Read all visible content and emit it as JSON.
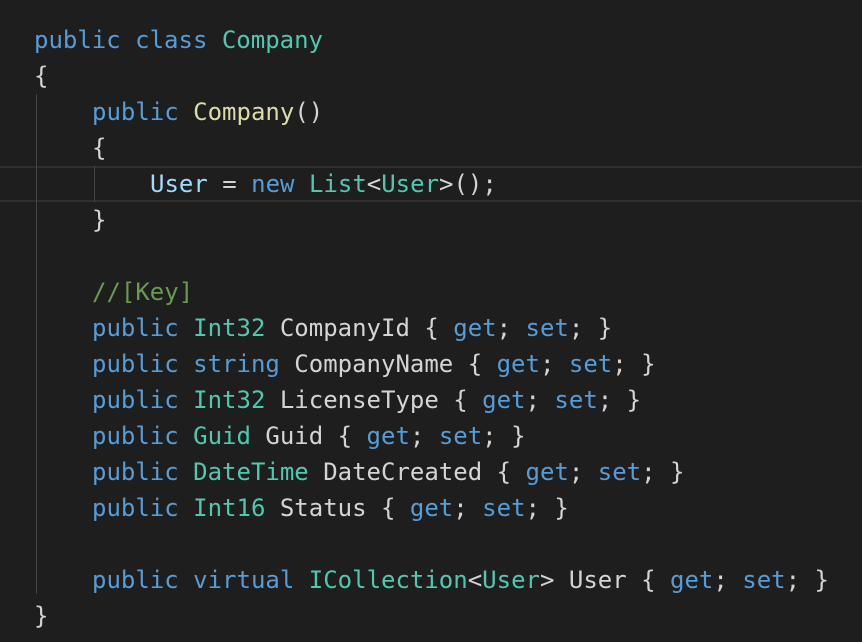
{
  "editor": {
    "colors": {
      "background": "#1e1e1e",
      "keyword": "#569cd6",
      "type": "#4ec9b0",
      "function": "#dcdcaa",
      "variable": "#9cdcfe",
      "comment": "#6a9955",
      "plain": "#d4d4d4"
    },
    "lines": [
      {
        "tokens": [
          {
            "t": "public",
            "c": "kw"
          },
          {
            "t": " ",
            "c": "pl"
          },
          {
            "t": "class",
            "c": "kw"
          },
          {
            "t": " ",
            "c": "pl"
          },
          {
            "t": "Company",
            "c": "type"
          }
        ]
      },
      {
        "tokens": [
          {
            "t": "{",
            "c": "pl"
          }
        ]
      },
      {
        "tokens": [
          {
            "t": "public",
            "c": "kw"
          },
          {
            "t": " ",
            "c": "pl"
          },
          {
            "t": "Company",
            "c": "fn"
          },
          {
            "t": "()",
            "c": "pl"
          }
        ]
      },
      {
        "tokens": [
          {
            "t": "{",
            "c": "pl"
          }
        ]
      },
      {
        "tokens": [
          {
            "t": "User",
            "c": "var"
          },
          {
            "t": " = ",
            "c": "pl"
          },
          {
            "t": "new",
            "c": "kw"
          },
          {
            "t": " ",
            "c": "pl"
          },
          {
            "t": "List",
            "c": "type"
          },
          {
            "t": "<",
            "c": "pl"
          },
          {
            "t": "User",
            "c": "type"
          },
          {
            "t": ">();",
            "c": "pl"
          }
        ]
      },
      {
        "tokens": [
          {
            "t": "}",
            "c": "pl"
          }
        ]
      },
      {
        "tokens": []
      },
      {
        "tokens": [
          {
            "t": "//[Key]",
            "c": "cm"
          }
        ]
      },
      {
        "tokens": [
          {
            "t": "public",
            "c": "kw"
          },
          {
            "t": " ",
            "c": "pl"
          },
          {
            "t": "Int32",
            "c": "type"
          },
          {
            "t": " CompanyId { ",
            "c": "pl"
          },
          {
            "t": "get",
            "c": "kw"
          },
          {
            "t": "; ",
            "c": "pl"
          },
          {
            "t": "set",
            "c": "kw"
          },
          {
            "t": "; }",
            "c": "pl"
          }
        ]
      },
      {
        "tokens": [
          {
            "t": "public",
            "c": "kw"
          },
          {
            "t": " ",
            "c": "pl"
          },
          {
            "t": "string",
            "c": "kw"
          },
          {
            "t": " CompanyName { ",
            "c": "pl"
          },
          {
            "t": "get",
            "c": "kw"
          },
          {
            "t": "; ",
            "c": "pl"
          },
          {
            "t": "set",
            "c": "kw"
          },
          {
            "t": "; }",
            "c": "pl"
          }
        ]
      },
      {
        "tokens": [
          {
            "t": "public",
            "c": "kw"
          },
          {
            "t": " ",
            "c": "pl"
          },
          {
            "t": "Int32",
            "c": "type"
          },
          {
            "t": " LicenseType { ",
            "c": "pl"
          },
          {
            "t": "get",
            "c": "kw"
          },
          {
            "t": "; ",
            "c": "pl"
          },
          {
            "t": "set",
            "c": "kw"
          },
          {
            "t": "; }",
            "c": "pl"
          }
        ]
      },
      {
        "tokens": [
          {
            "t": "public",
            "c": "kw"
          },
          {
            "t": " ",
            "c": "pl"
          },
          {
            "t": "Guid",
            "c": "type"
          },
          {
            "t": " Guid { ",
            "c": "pl"
          },
          {
            "t": "get",
            "c": "kw"
          },
          {
            "t": "; ",
            "c": "pl"
          },
          {
            "t": "set",
            "c": "kw"
          },
          {
            "t": "; }",
            "c": "pl"
          }
        ]
      },
      {
        "tokens": [
          {
            "t": "public",
            "c": "kw"
          },
          {
            "t": " ",
            "c": "pl"
          },
          {
            "t": "DateTime",
            "c": "type"
          },
          {
            "t": " DateCreated { ",
            "c": "pl"
          },
          {
            "t": "get",
            "c": "kw"
          },
          {
            "t": "; ",
            "c": "pl"
          },
          {
            "t": "set",
            "c": "kw"
          },
          {
            "t": "; }",
            "c": "pl"
          }
        ]
      },
      {
        "tokens": [
          {
            "t": "public",
            "c": "kw"
          },
          {
            "t": " ",
            "c": "pl"
          },
          {
            "t": "Int16",
            "c": "type"
          },
          {
            "t": " Status { ",
            "c": "pl"
          },
          {
            "t": "get",
            "c": "kw"
          },
          {
            "t": "; ",
            "c": "pl"
          },
          {
            "t": "set",
            "c": "kw"
          },
          {
            "t": "; }",
            "c": "pl"
          }
        ]
      },
      {
        "tokens": []
      },
      {
        "tokens": [
          {
            "t": "public",
            "c": "kw"
          },
          {
            "t": " ",
            "c": "pl"
          },
          {
            "t": "virtual",
            "c": "kw"
          },
          {
            "t": " ",
            "c": "pl"
          },
          {
            "t": "ICollection",
            "c": "type"
          },
          {
            "t": "<",
            "c": "pl"
          },
          {
            "t": "User",
            "c": "type"
          },
          {
            "t": "> User { ",
            "c": "pl"
          },
          {
            "t": "get",
            "c": "kw"
          },
          {
            "t": "; ",
            "c": "pl"
          },
          {
            "t": "set",
            "c": "kw"
          },
          {
            "t": "; }",
            "c": "pl"
          }
        ]
      },
      {
        "tokens": [
          {
            "t": "}",
            "c": "pl"
          }
        ]
      }
    ]
  }
}
